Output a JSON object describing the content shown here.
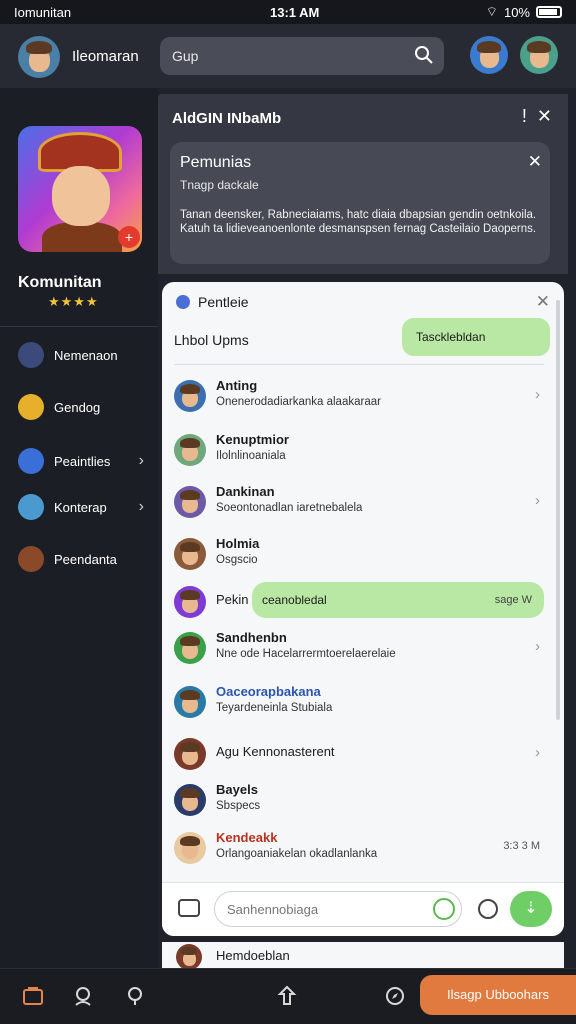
{
  "status_bar": {
    "carrier": "Iomunitan",
    "time": "13:1 AM",
    "battery": "10%"
  },
  "topbar": {
    "username": "Ileomaran",
    "search_placeholder": "Gup"
  },
  "sidebar": {
    "profile_name": "Komunitan",
    "stars": "★★★★",
    "items": [
      {
        "label": "Nemenaon",
        "icon": "gift-icon",
        "color": "#3b4a7a"
      },
      {
        "label": "Gendog",
        "icon": "avatar-icon",
        "color": "#e6b02a"
      },
      {
        "label": "Peaintlies",
        "icon": "calendar-icon",
        "color": "#3a6fd8"
      },
      {
        "label": "Konterap",
        "icon": "avatar-icon",
        "color": "#4a9ad0"
      },
      {
        "label": "Peendanta",
        "icon": "avatar-icon",
        "color": "#8a4a2a"
      }
    ]
  },
  "notification": {
    "header": "AldGIN INbaMb",
    "card_title": "Pemunias",
    "card_sub": "Tnagp dackale",
    "card_body": "Tanan deensker, Rabneciaiams, hatc diaia dbapsian gendin oetnkoila. Katuh ta lidieveanoenlonte desmanspsen fernag Casteilaio Daoperns."
  },
  "chat": {
    "title": "Pentleie",
    "subtitle": "Lhbol Upms",
    "pill": "Tascklebldan",
    "rows": [
      {
        "name": "Anting",
        "msg": "Onenerodadiarkanka alaakaraar",
        "avatar": "#3c6fb0"
      },
      {
        "name": "Kenuptmior",
        "msg": "Ilolnlinoaniala",
        "avatar": "#6fa87a"
      },
      {
        "name": "Dankinan",
        "msg": "Soeontonadlan iaretnebalela",
        "avatar": "#6b5aa8"
      },
      {
        "name": "Holmia",
        "msg": "Osgscio",
        "avatar": "#8a5a3a"
      },
      {
        "name": "Pekin",
        "msg": "",
        "avatar": "#7e3bd6"
      },
      {
        "name": "Sandhenbn",
        "msg": "Nne ode Hacelarrermtoerelaerelaie",
        "avatar": "#3aa04a"
      },
      {
        "name": "Oaceorapbakana",
        "msg": "Teyardeneinla Stubiala",
        "avatar": "#2a7aa8"
      },
      {
        "name": "Agu Kennonasterent",
        "msg": "",
        "avatar": "#7a3a2a"
      },
      {
        "name": "Bayels",
        "msg": "Sbspecs",
        "avatar": "#2a3a6a"
      },
      {
        "name": "Kendeakk",
        "msg": "Orlangoaniakelan okadlanlanka",
        "avatar": "#e8c9a0"
      }
    ],
    "bubble_text": "ceanobledal",
    "bubble_time": "sage W",
    "last_time": "3:3 3 M",
    "composer_placeholder": "Sanhennobiaga",
    "below_name": "Hemdoeblan"
  },
  "bottom_nav": {
    "cta": "Ilsagp Ubboohars"
  }
}
